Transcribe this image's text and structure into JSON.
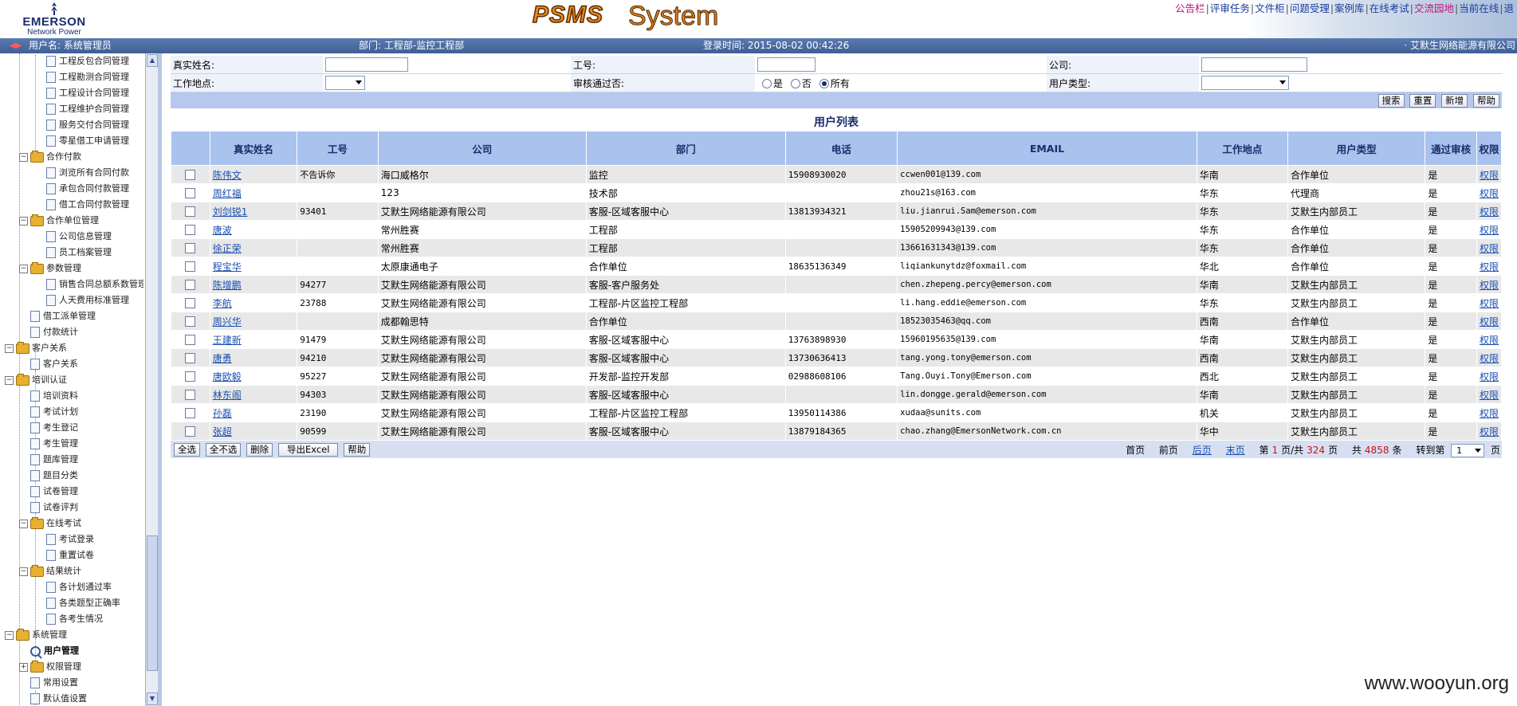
{
  "header": {
    "logo_brand": "EMERSON",
    "logo_sub": "Network Power",
    "title_main": "PSMS",
    "title_sub": "System",
    "top_links": [
      "公告栏",
      "评审任务",
      "文件柜",
      "问题受理",
      "案例库",
      "在线考试",
      "交流园地",
      "当前在线",
      "退"
    ]
  },
  "status": {
    "user": "用户名: 系统管理员",
    "dept": "部门: 工程部-监控工程部",
    "login_time": "登录时间: 2015-08-02 00:42:26",
    "company": "· 艾默生网络能源有限公司"
  },
  "sidebar": {
    "nodes": [
      {
        "label": "工程反包合同管理",
        "level": 3,
        "type": "page"
      },
      {
        "label": "工程勘测合同管理",
        "level": 3,
        "type": "page"
      },
      {
        "label": "工程设计合同管理",
        "level": 3,
        "type": "page"
      },
      {
        "label": "工程维护合同管理",
        "level": 3,
        "type": "page"
      },
      {
        "label": "服务交付合同管理",
        "level": 3,
        "type": "page"
      },
      {
        "label": "零星借工申请管理",
        "level": 3,
        "type": "page"
      },
      {
        "label": "合作付款",
        "level": 2,
        "type": "folder",
        "exp": "−"
      },
      {
        "label": "浏览所有合同付款",
        "level": 3,
        "type": "page"
      },
      {
        "label": "承包合同付款管理",
        "level": 3,
        "type": "page"
      },
      {
        "label": "借工合同付款管理",
        "level": 3,
        "type": "page"
      },
      {
        "label": "合作单位管理",
        "level": 2,
        "type": "folder",
        "exp": "−"
      },
      {
        "label": "公司信息管理",
        "level": 3,
        "type": "page"
      },
      {
        "label": "员工档案管理",
        "level": 3,
        "type": "page"
      },
      {
        "label": "参数管理",
        "level": 2,
        "type": "folder",
        "exp": "−"
      },
      {
        "label": "销售合同总额系数管理",
        "level": 3,
        "type": "page"
      },
      {
        "label": "人天费用标准管理",
        "level": 3,
        "type": "page"
      },
      {
        "label": "借工派单管理",
        "level": 2,
        "type": "page"
      },
      {
        "label": "付款统计",
        "level": 2,
        "type": "page"
      },
      {
        "label": "客户关系",
        "level": 1,
        "type": "folder",
        "exp": "−"
      },
      {
        "label": "客户关系",
        "level": 2,
        "type": "page"
      },
      {
        "label": "培训认证",
        "level": 1,
        "type": "folder",
        "exp": "−"
      },
      {
        "label": "培训资料",
        "level": 2,
        "type": "page"
      },
      {
        "label": "考试计划",
        "level": 2,
        "type": "page"
      },
      {
        "label": "考生登记",
        "level": 2,
        "type": "page"
      },
      {
        "label": "考生管理",
        "level": 2,
        "type": "page"
      },
      {
        "label": "题库管理",
        "level": 2,
        "type": "page"
      },
      {
        "label": "题目分类",
        "level": 2,
        "type": "page"
      },
      {
        "label": "试卷管理",
        "level": 2,
        "type": "page"
      },
      {
        "label": "试卷评判",
        "level": 2,
        "type": "page"
      },
      {
        "label": "在线考试",
        "level": 2,
        "type": "folder",
        "exp": "−"
      },
      {
        "label": "考试登录",
        "level": 3,
        "type": "page"
      },
      {
        "label": "重置试卷",
        "level": 3,
        "type": "page"
      },
      {
        "label": "结果统计",
        "level": 2,
        "type": "folder",
        "exp": "−"
      },
      {
        "label": "各计划通过率",
        "level": 3,
        "type": "page"
      },
      {
        "label": "各类题型正确率",
        "level": 3,
        "type": "page"
      },
      {
        "label": "各考生情况",
        "level": 3,
        "type": "page"
      },
      {
        "label": "系统管理",
        "level": 1,
        "type": "folder",
        "exp": "−"
      },
      {
        "label": "用户管理",
        "level": 2,
        "type": "search",
        "bold": true
      },
      {
        "label": "权限管理",
        "level": 2,
        "type": "folder",
        "exp": "+"
      },
      {
        "label": "常用设置",
        "level": 2,
        "type": "page"
      },
      {
        "label": "默认值设置",
        "level": 2,
        "type": "page"
      }
    ]
  },
  "search": {
    "real_name_label": "真实姓名:",
    "real_name_value": "",
    "emp_no_label": "工号:",
    "emp_no_value": "",
    "company_label": "公司:",
    "company_value": "",
    "location_label": "工作地点:",
    "location_value": "",
    "approved_label": "审核通过否:",
    "approved_yes": "是",
    "approved_no": "否",
    "approved_all": "所有",
    "user_type_label": "用户类型:",
    "user_type_value": ""
  },
  "actions": {
    "search": "搜索",
    "reset": "重置",
    "add": "新增",
    "help": "帮助"
  },
  "list": {
    "title": "用户列表",
    "columns": [
      "真实姓名",
      "工号",
      "公司",
      "部门",
      "电话",
      "EMAIL",
      "工作地点",
      "用户类型",
      "通过审核",
      "权限"
    ],
    "rows": [
      {
        "name": "陈伟文",
        "no": "不告诉你",
        "company": "海口威格尔",
        "dept": "监控",
        "phone": "15908930020",
        "email": "ccwen001@139.com",
        "loc": "华南",
        "type": "合作单位",
        "approved": "是",
        "perm": "权限"
      },
      {
        "name": "周红福",
        "no": "",
        "company": "123",
        "dept": "技术部",
        "phone": "",
        "email": "zhou21s@163.com",
        "loc": "华东",
        "type": "代理商",
        "approved": "是",
        "perm": "权限"
      },
      {
        "name": "刘剑锐1",
        "no": "93401",
        "company": "艾默生网络能源有限公司",
        "dept": "客服-区域客服中心",
        "phone": "13813934321",
        "email": "liu.jianrui.Sam@emerson.com",
        "loc": "华东",
        "type": "艾默生内部员工",
        "approved": "是",
        "perm": "权限"
      },
      {
        "name": "唐波",
        "no": "",
        "company": "常州胜赛",
        "dept": "工程部",
        "phone": "",
        "email": "15905209943@139.com",
        "loc": "华东",
        "type": "合作单位",
        "approved": "是",
        "perm": "权限"
      },
      {
        "name": "徐正荣",
        "no": "",
        "company": "常州胜赛",
        "dept": "工程部",
        "phone": "",
        "email": "13661631343@139.com",
        "loc": "华东",
        "type": "合作单位",
        "approved": "是",
        "perm": "权限"
      },
      {
        "name": "程宝华",
        "no": "",
        "company": "太原康通电子",
        "dept": "合作单位",
        "phone": "18635136349",
        "email": "liqiankunytdz@foxmail.com",
        "loc": "华北",
        "type": "合作单位",
        "approved": "是",
        "perm": "权限"
      },
      {
        "name": "陈增鹏",
        "no": "94277",
        "company": "艾默生网络能源有限公司",
        "dept": "客服-客户服务处",
        "phone": "",
        "email": "chen.zhepeng.percy@emerson.com",
        "loc": "华南",
        "type": "艾默生内部员工",
        "approved": "是",
        "perm": "权限"
      },
      {
        "name": "李航",
        "no": "23788",
        "company": "艾默生网络能源有限公司",
        "dept": "工程部-片区监控工程部",
        "phone": "",
        "email": "li.hang.eddie@emerson.com",
        "loc": "华东",
        "type": "艾默生内部员工",
        "approved": "是",
        "perm": "权限"
      },
      {
        "name": "周兴华",
        "no": "",
        "company": "成都翰思特",
        "dept": "合作单位",
        "phone": "",
        "email": "18523035463@qq.com",
        "loc": "西南",
        "type": "合作单位",
        "approved": "是",
        "perm": "权限"
      },
      {
        "name": "王建新",
        "no": "91479",
        "company": "艾默生网络能源有限公司",
        "dept": "客服-区域客服中心",
        "phone": "13763898930",
        "email": "15960195635@139.com",
        "loc": "华南",
        "type": "艾默生内部员工",
        "approved": "是",
        "perm": "权限"
      },
      {
        "name": "唐勇",
        "no": "94210",
        "company": "艾默生网络能源有限公司",
        "dept": "客服-区域客服中心",
        "phone": "13730636413",
        "email": "tang.yong.tony@emerson.com",
        "loc": "西南",
        "type": "艾默生内部员工",
        "approved": "是",
        "perm": "权限"
      },
      {
        "name": "唐欧毅",
        "no": "95227",
        "company": "艾默生网络能源有限公司",
        "dept": "开发部-监控开发部",
        "phone": "02988608106",
        "email": "Tang.Ouyi.Tony@Emerson.com",
        "loc": "西北",
        "type": "艾默生内部员工",
        "approved": "是",
        "perm": "权限"
      },
      {
        "name": "林东阁",
        "no": "94303",
        "company": "艾默生网络能源有限公司",
        "dept": "客服-区域客服中心",
        "phone": "",
        "email": "lin.dongge.gerald@emerson.com",
        "loc": "华南",
        "type": "艾默生内部员工",
        "approved": "是",
        "perm": "权限"
      },
      {
        "name": "孙磊",
        "no": "23190",
        "company": "艾默生网络能源有限公司",
        "dept": "工程部-片区监控工程部",
        "phone": "13950114386",
        "email": "xudaa@sunits.com",
        "loc": "机关",
        "type": "艾默生内部员工",
        "approved": "是",
        "perm": "权限"
      },
      {
        "name": "张超",
        "no": "90599",
        "company": "艾默生网络能源有限公司",
        "dept": "客服-区域客服中心",
        "phone": "13879184365",
        "email": "chao.zhang@EmersonNetwork.com.cn",
        "loc": "华中",
        "type": "艾默生内部员工",
        "approved": "是",
        "perm": "权限"
      }
    ]
  },
  "footer": {
    "select_all": "全选",
    "unselect_all": "全不选",
    "delete": "删除",
    "export": "导出Excel",
    "help": "帮助",
    "first": "首页",
    "prev": "前页",
    "next": "后页",
    "last": "末页",
    "page_prefix": "第",
    "page_current": "1",
    "page_mid": "页/共",
    "page_total": "324",
    "page_suffix": "页",
    "count_prefix": "共",
    "count_total": "4858",
    "count_suffix": "条",
    "goto_label": "转到第",
    "goto_value": "1",
    "goto_suffix": "页"
  },
  "watermark": "www.wooyun.org",
  "colors": {
    "statusbar": "#4f6fa5",
    "table_header": "#aac2ee",
    "link": "#1a4fb0",
    "top_link": "#c0147a",
    "title_orange": "#f08a1c"
  }
}
